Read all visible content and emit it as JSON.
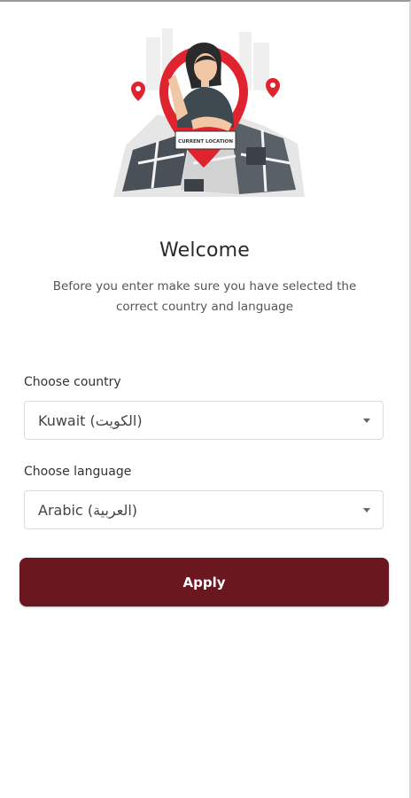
{
  "illustration": {
    "sign_text": "CURRENT LOCATION",
    "icon": "location-map-illustration",
    "colors": {
      "pin": "#e0242f",
      "map": "#4a5058"
    }
  },
  "welcome": {
    "title": "Welcome",
    "subtitle": "Before you enter make sure you have selected the correct country and language"
  },
  "country": {
    "label": "Choose country",
    "selected": "Kuwait (الكويت)"
  },
  "language": {
    "label": "Choose language",
    "selected": "Arabic (العربية)"
  },
  "apply": {
    "label": "Apply",
    "color": "#6b1720"
  }
}
